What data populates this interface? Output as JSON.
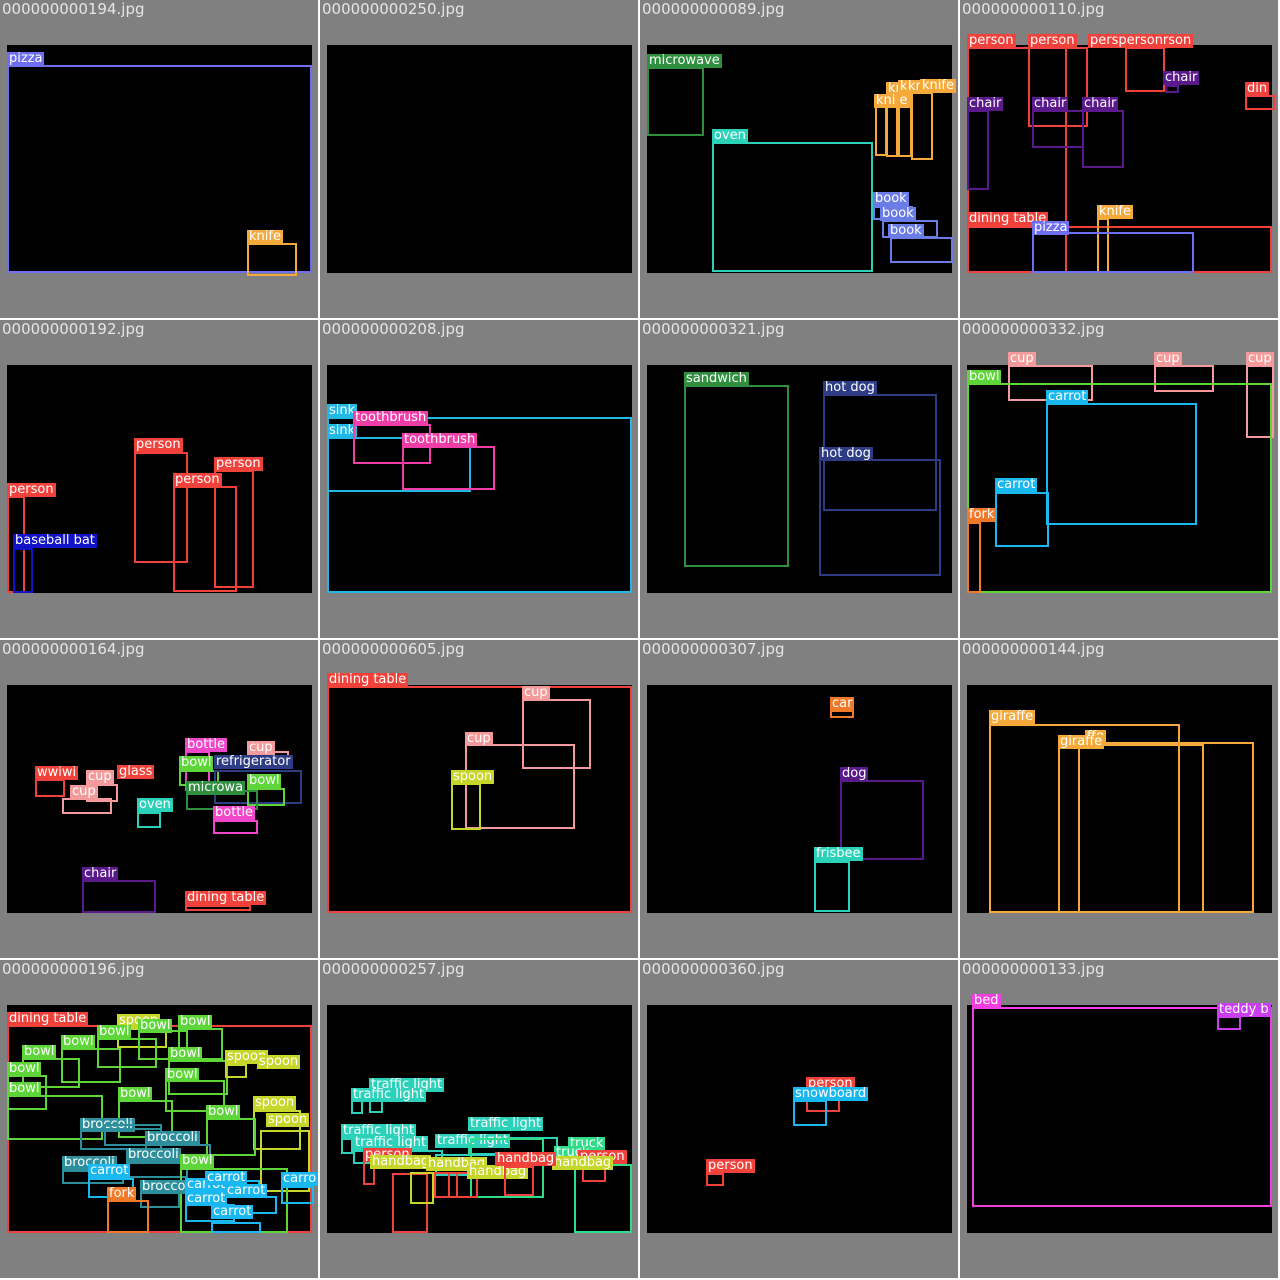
{
  "colors": {
    "pizza": "#6e6ef2",
    "knife": "#f5a93a",
    "microwave": "#2f8f3f",
    "oven": "#2bd1b8",
    "book": "#6a7de6",
    "person": "#f0413a",
    "chair": "#5b1a8c",
    "dining_table": "#f0413a",
    "baseball_bat": "#1212c8",
    "sink": "#22b8e6",
    "toothbrush": "#f03ea8",
    "sandwich": "#2f8f3f",
    "hot_dog": "#2e3c86",
    "cup": "#f49a9a",
    "bowl": "#5ed63a",
    "carrot": "#1ab8f0",
    "fork": "#f07a2a",
    "bottle": "#f046c9",
    "refrigerator": "#2e3c86",
    "wine_glass": "#f0413a",
    "spoon": "#c7d62a",
    "car": "#f07a2a",
    "dog": "#5b1a8c",
    "frisbee": "#2bd1b8",
    "giraffe": "#f5a93a",
    "broccoli": "#2e8f9c",
    "traffic_light": "#2bd1b8",
    "handbag": "#c7d62a",
    "truck": "#2fdc8a",
    "snowboard": "#1ab8f0",
    "bed": "#f03ee0",
    "teddy_bear": "#c83ef0"
  },
  "tiles": [
    {
      "filename": "000000000194.jpg",
      "labels": [
        "pizza",
        "knife"
      ]
    },
    {
      "filename": "000000000250.jpg",
      "labels": []
    },
    {
      "filename": "000000000089.jpg",
      "labels": [
        "microwave",
        "oven",
        "kni",
        "k",
        "kr",
        "knife",
        "kni e",
        "book",
        "book",
        "book"
      ]
    },
    {
      "filename": "000000000110.jpg",
      "labels": [
        "person",
        "person",
        "perspersonrson",
        "chair",
        "din",
        "chair",
        "chair",
        "chair",
        "dining table",
        "knife",
        "pizza"
      ]
    },
    {
      "filename": "000000000192.jpg",
      "labels": [
        "person",
        "person",
        "person",
        "person",
        "baseball bat"
      ]
    },
    {
      "filename": "000000000208.jpg",
      "labels": [
        "sink",
        "sink",
        "toothbrush",
        "toothbrush"
      ]
    },
    {
      "filename": "000000000321.jpg",
      "labels": [
        "sandwich",
        "hot dog",
        "hot dog"
      ]
    },
    {
      "filename": "000000000332.jpg",
      "labels": [
        "cup",
        "cup",
        "cup",
        "bowl",
        "carrot",
        "carrot",
        "fork"
      ]
    },
    {
      "filename": "000000000164.jpg",
      "labels": [
        "bottle",
        "cup",
        "bowl",
        "refrigerator",
        "wwiwi",
        "glass",
        "cup",
        "cup",
        "bowl",
        "microwa",
        "oven",
        "bottle",
        "chair",
        "dining table"
      ]
    },
    {
      "filename": "000000000605.jpg",
      "labels": [
        "dining table",
        "cup",
        "cup",
        "spoon"
      ]
    },
    {
      "filename": "000000000307.jpg",
      "labels": [
        "car",
        "dog",
        "frisbee"
      ]
    },
    {
      "filename": "000000000144.jpg",
      "labels": [
        "giraffe",
        "ffe",
        "giraffe"
      ]
    },
    {
      "filename": "000000000196.jpg",
      "labels": [
        "dining table",
        "spoon",
        "bowl",
        "bowl",
        "bowl",
        "bowl",
        "bowl",
        "bowl",
        "bowl",
        "bowl",
        "spoon",
        "spoon",
        "bowl",
        "bowl",
        "spoon",
        "bowl",
        "broccoli",
        "broccoli",
        "broccoli",
        "spoon",
        "broccoli",
        "carrot",
        "bowl",
        "broccoli",
        "carrot",
        "carrot",
        "carrot",
        "fork",
        "carrot",
        "carrot",
        "carro"
      ]
    },
    {
      "filename": "000000000257.jpg",
      "labels": [
        "traffic light",
        "traffic light",
        "traffic light",
        "traffic light",
        "traffic light",
        "traffic light",
        "truck",
        "person",
        "handbag",
        "handbag",
        "handbag",
        "handbag",
        "person",
        "truck",
        "handbag"
      ]
    },
    {
      "filename": "000000000360.jpg",
      "labels": [
        "person",
        "snowboard",
        "person"
      ]
    },
    {
      "filename": "000000000133.jpg",
      "labels": [
        "bed",
        "teddy b"
      ]
    }
  ]
}
